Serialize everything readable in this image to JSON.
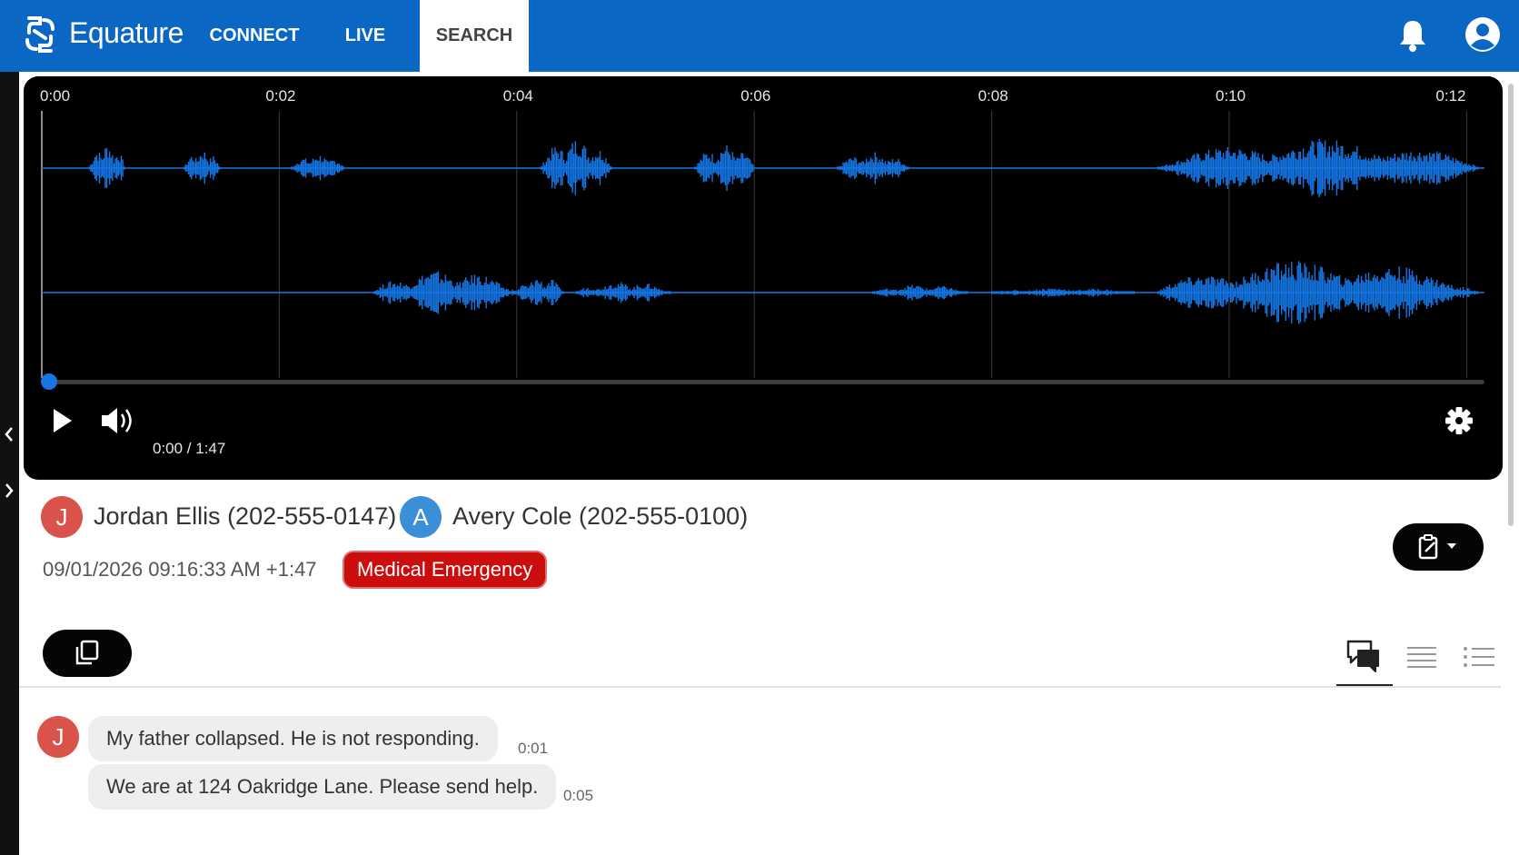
{
  "header": {
    "brand": "Equature",
    "nav": [
      {
        "label": "CONNECT"
      },
      {
        "label": "LIVE"
      },
      {
        "label": "SEARCH",
        "active": true
      }
    ],
    "colors": {
      "bar": "#0a67c4",
      "active_tab_bg": "#ffffff"
    },
    "icons": {
      "notifications": "bell-icon",
      "account": "account-icon"
    }
  },
  "player": {
    "timeline_labels": [
      "0:00",
      "0:02",
      "0:04",
      "0:06",
      "0:08",
      "0:10",
      "0:12"
    ],
    "current_time": "0:00",
    "duration": "1:47",
    "time_display": "0:00 / 1:47",
    "progress": 0,
    "waveform_color": "#1577e6",
    "channels": [
      {
        "name": "channel-1",
        "bursts": [
          [
            0.4,
            0.7,
            0.8
          ],
          [
            1.2,
            1.5,
            0.6
          ],
          [
            2.1,
            2.55,
            0.45
          ],
          [
            4.2,
            4.8,
            0.95
          ],
          [
            5.5,
            6.0,
            0.75
          ],
          [
            6.7,
            7.3,
            0.5
          ],
          [
            9.4,
            12.1,
            0.9
          ]
        ]
      },
      {
        "name": "channel-2",
        "bursts": [
          [
            2.8,
            4.0,
            0.7
          ],
          [
            4.0,
            4.4,
            0.5
          ],
          [
            4.5,
            5.3,
            0.35
          ],
          [
            7.0,
            7.8,
            0.25
          ],
          [
            8.0,
            9.2,
            0.15
          ],
          [
            9.4,
            12.1,
            1.0
          ]
        ]
      }
    ]
  },
  "call": {
    "caller": {
      "initial": "J",
      "label": "Jordan Ellis (202-555-0147)",
      "color": "#d9534a"
    },
    "separator": "-",
    "callee": {
      "initial": "A",
      "label": "Avery Cole (202-555-0100)",
      "color": "#3b8fd9"
    },
    "timestamp": "09/01/2026 09:16:33 AM +1:47",
    "tag": "Medical Emergency",
    "tag_color": "#cc0d0d"
  },
  "transcript": {
    "views": [
      "chat-view-icon",
      "text-view-icon",
      "list-view-icon"
    ],
    "active_view": 0,
    "messages": [
      {
        "speaker": "J",
        "text": "My father collapsed. He is not responding.",
        "time": "0:01"
      },
      {
        "speaker": "J",
        "text": "We are at 124 Oakridge Lane. Please send help.",
        "time": "0:05"
      }
    ]
  }
}
